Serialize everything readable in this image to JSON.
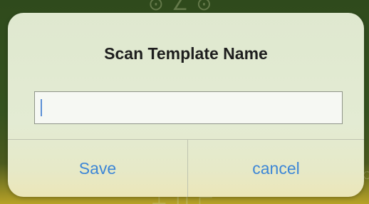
{
  "dialog": {
    "title": "Scan Template Name",
    "input": {
      "value": "",
      "placeholder": ""
    },
    "buttons": {
      "save_label": "Save",
      "cancel_label": "cancel"
    }
  },
  "colors": {
    "accent": "#3d86d6",
    "dialog_bg": "#e3ebd3",
    "backdrop": "#35521f"
  }
}
